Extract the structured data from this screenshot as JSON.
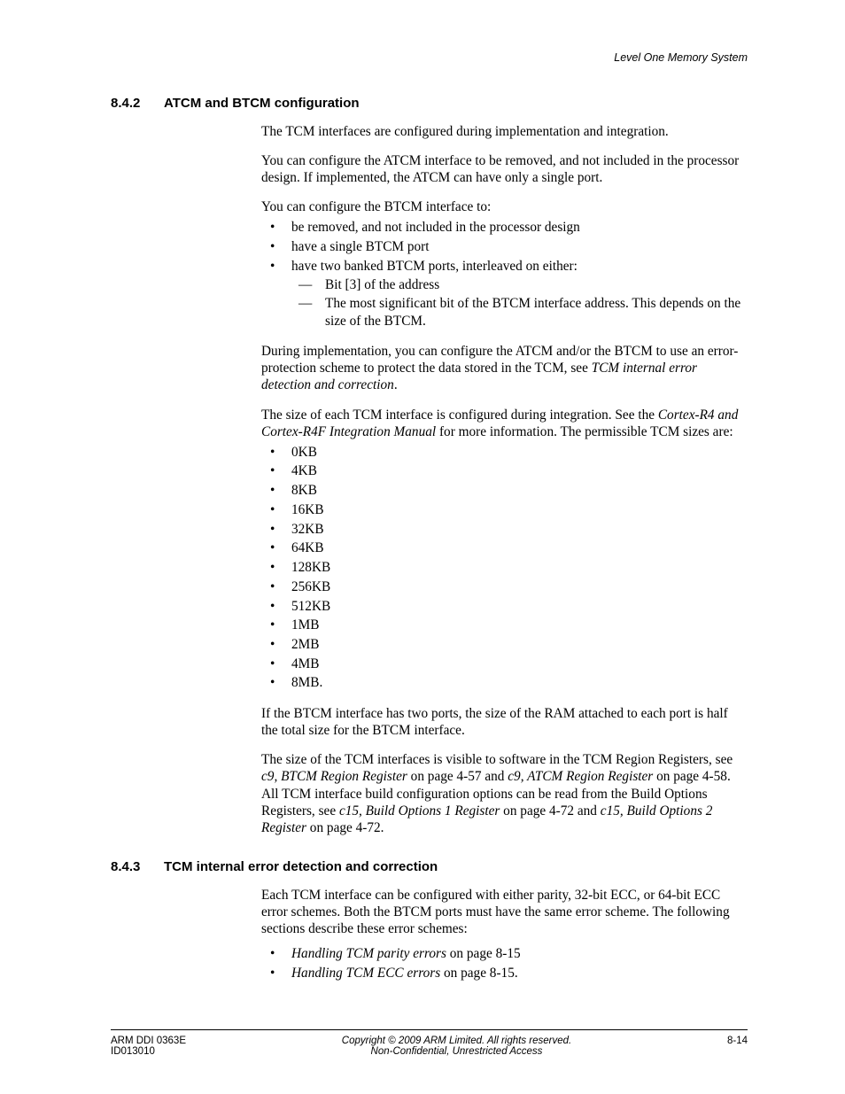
{
  "running_header": "Level One Memory System",
  "s842": {
    "num": "8.4.2",
    "title": "ATCM and BTCM configuration",
    "p1": "The TCM interfaces are configured during implementation and integration.",
    "p2": "You can configure the ATCM interface to be removed, and not included in the processor design. If implemented, the ATCM can have only a single port.",
    "p3": "You can configure the BTCM interface to:",
    "cfg": {
      "i1": "be removed, and not included in the processor design",
      "i2": "have a single BTCM port",
      "i3": "have two banked BTCM ports, interleaved on either:",
      "s1": "Bit [3] of the address",
      "s2": "The most significant bit of the BTCM interface address. This depends on the size of the BTCM."
    },
    "p4a": "During implementation, you can configure the ATCM and/or the BTCM to use an error-protection scheme to protect the data stored in the TCM, see ",
    "p4b": "TCM internal error detection and correction",
    "p4c": ".",
    "p5a": "The size of each TCM interface is configured during integration. See the ",
    "p5b": "Cortex-R4 and Cortex-R4F Integration Manual",
    "p5c": " for more information. The permissible TCM sizes are:",
    "sizes": [
      "0KB",
      "4KB",
      "8KB",
      "16KB",
      "32KB",
      "64KB",
      "128KB",
      "256KB",
      "512KB",
      "1MB",
      "2MB",
      "4MB",
      "8MB."
    ],
    "p6": "If the BTCM interface has two ports, the size of the RAM attached to each port is half the total size for the BTCM interface.",
    "p7a": "The size of the TCM interfaces is visible to software in the TCM Region Registers, see ",
    "p7b": "c9, BTCM Region Register",
    "p7c": " on page 4-57 and ",
    "p7d": "c9, ATCM Region Register",
    "p7e": " on page 4-58. All TCM interface build configuration options can be read from the Build Options Registers, see ",
    "p7f": "c15, Build Options 1 Register",
    "p7g": " on page 4-72 and ",
    "p7h": "c15, Build Options 2 Register",
    "p7i": " on page 4-72."
  },
  "s843": {
    "num": "8.4.3",
    "title": "TCM internal error detection and correction",
    "p1": "Each TCM interface can be configured with either parity, 32-bit ECC, or 64-bit ECC error schemes. Both the BTCM ports must have the same error scheme. The following sections describe these error schemes:",
    "i1a": "Handling TCM parity errors",
    "i1b": " on page 8-15",
    "i2a": "Handling TCM ECC errors",
    "i2b": " on page 8-15."
  },
  "footer": {
    "l1": "ARM DDI 0363E",
    "l2": "ID013010",
    "c1": "Copyright © 2009 ARM Limited. All rights reserved.",
    "c2": "Non-Confidential, Unrestricted Access",
    "r1": "8-14"
  }
}
